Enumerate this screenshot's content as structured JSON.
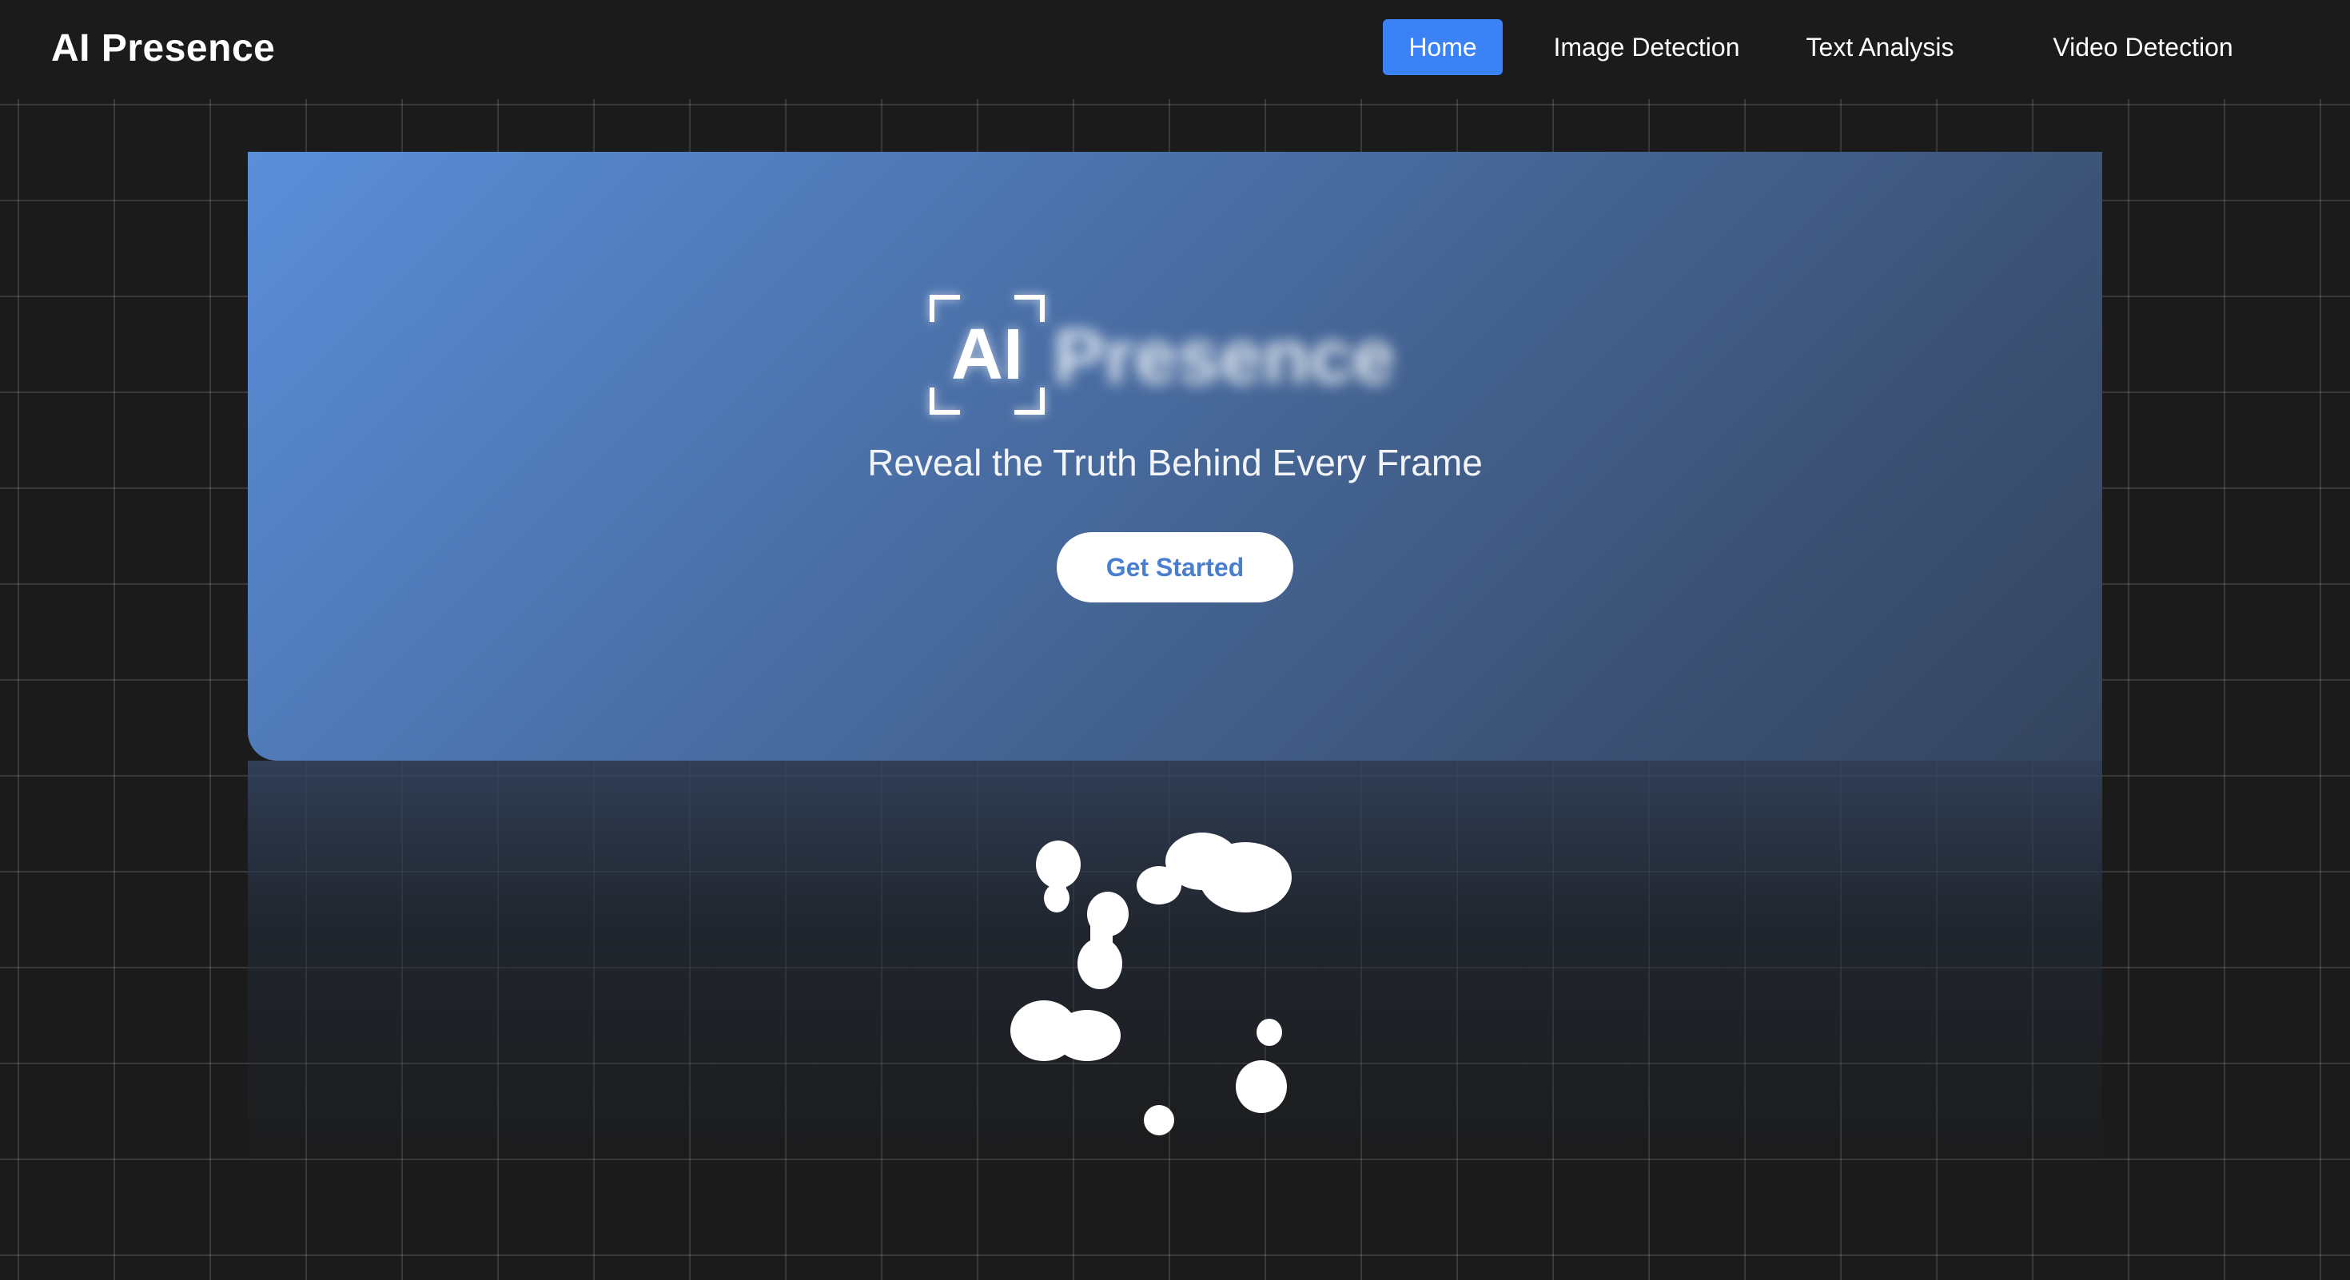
{
  "header": {
    "brand": "AI Presence",
    "nav": [
      {
        "label": "Home",
        "active": true
      },
      {
        "label": "Image Detection",
        "active": false
      },
      {
        "label": "Text Analysis",
        "active": false
      },
      {
        "label": "Video Detection",
        "active": false
      }
    ]
  },
  "hero": {
    "logo_mark": "AI",
    "logo_word": "Presence",
    "tagline": "Reveal the Truth Behind Every Frame",
    "cta_label": "Get Started"
  },
  "colors": {
    "background": "#1b1b1b",
    "accent": "#3b82f6",
    "hero_gradient_start": "#5a8ed9",
    "hero_gradient_end": "#34445e",
    "cta_text": "#4a7fd0"
  },
  "icons": {
    "logo_frame": "corner-brackets-icon",
    "loader": "liquid-blobs-loader"
  }
}
